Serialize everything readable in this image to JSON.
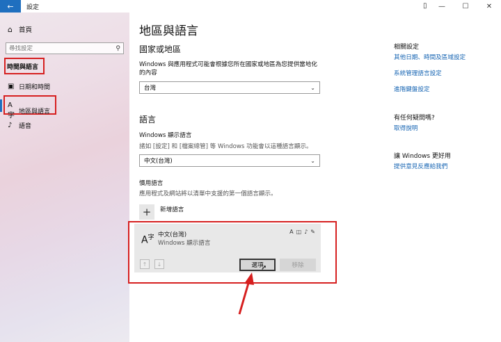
{
  "titlebar": {
    "back_glyph": "←",
    "title": "設定",
    "minimize": "—",
    "maximize": "☐",
    "close": "✕"
  },
  "sidebar": {
    "home_label": "首頁",
    "search_placeholder": "尋找設定",
    "group_title": "時間與語言",
    "items": [
      {
        "label": "日期和時間",
        "icon": "calendar-clock-icon"
      },
      {
        "label": "地區與語言",
        "icon": "language-icon"
      },
      {
        "label": "語音",
        "icon": "microphone-icon"
      }
    ]
  },
  "main": {
    "title": "地區與語言",
    "country_section": {
      "heading": "國家或地區",
      "description": "Windows 與應用程式可能會根據您所在國家或地區為您提供當地化的內容",
      "selected": "台灣"
    },
    "language_section": {
      "heading": "語言",
      "display_label": "Windows 顯示語言",
      "display_desc": "諸如 [設定] 和 [檔案總管] 等 Windows 功能會以這種語言顯示。",
      "display_selected": "中文(台灣)",
      "preferred_label": "慣用語言",
      "preferred_desc": "應用程式及網站將以清單中支援的第一個語言顯示。",
      "add_language": "新增語言",
      "language_card": {
        "name": "中文(台灣)",
        "sub": "Windows 顯示語言",
        "options_button": "選項",
        "remove_button": "移除"
      }
    }
  },
  "right": {
    "related_heading": "相關設定",
    "related_links": [
      "其他日期、時間及區域設定",
      "系統管理語言設定",
      "進階鍵盤設定"
    ],
    "help_heading": "有任何疑問嗎?",
    "help_link": "取得說明",
    "improve_heading": "讓 Windows 更好用",
    "improve_link": "提供意見反應給我們"
  },
  "colors": {
    "accent": "#1f6fbf",
    "highlight": "#d61f1f",
    "link": "#1765b3"
  }
}
